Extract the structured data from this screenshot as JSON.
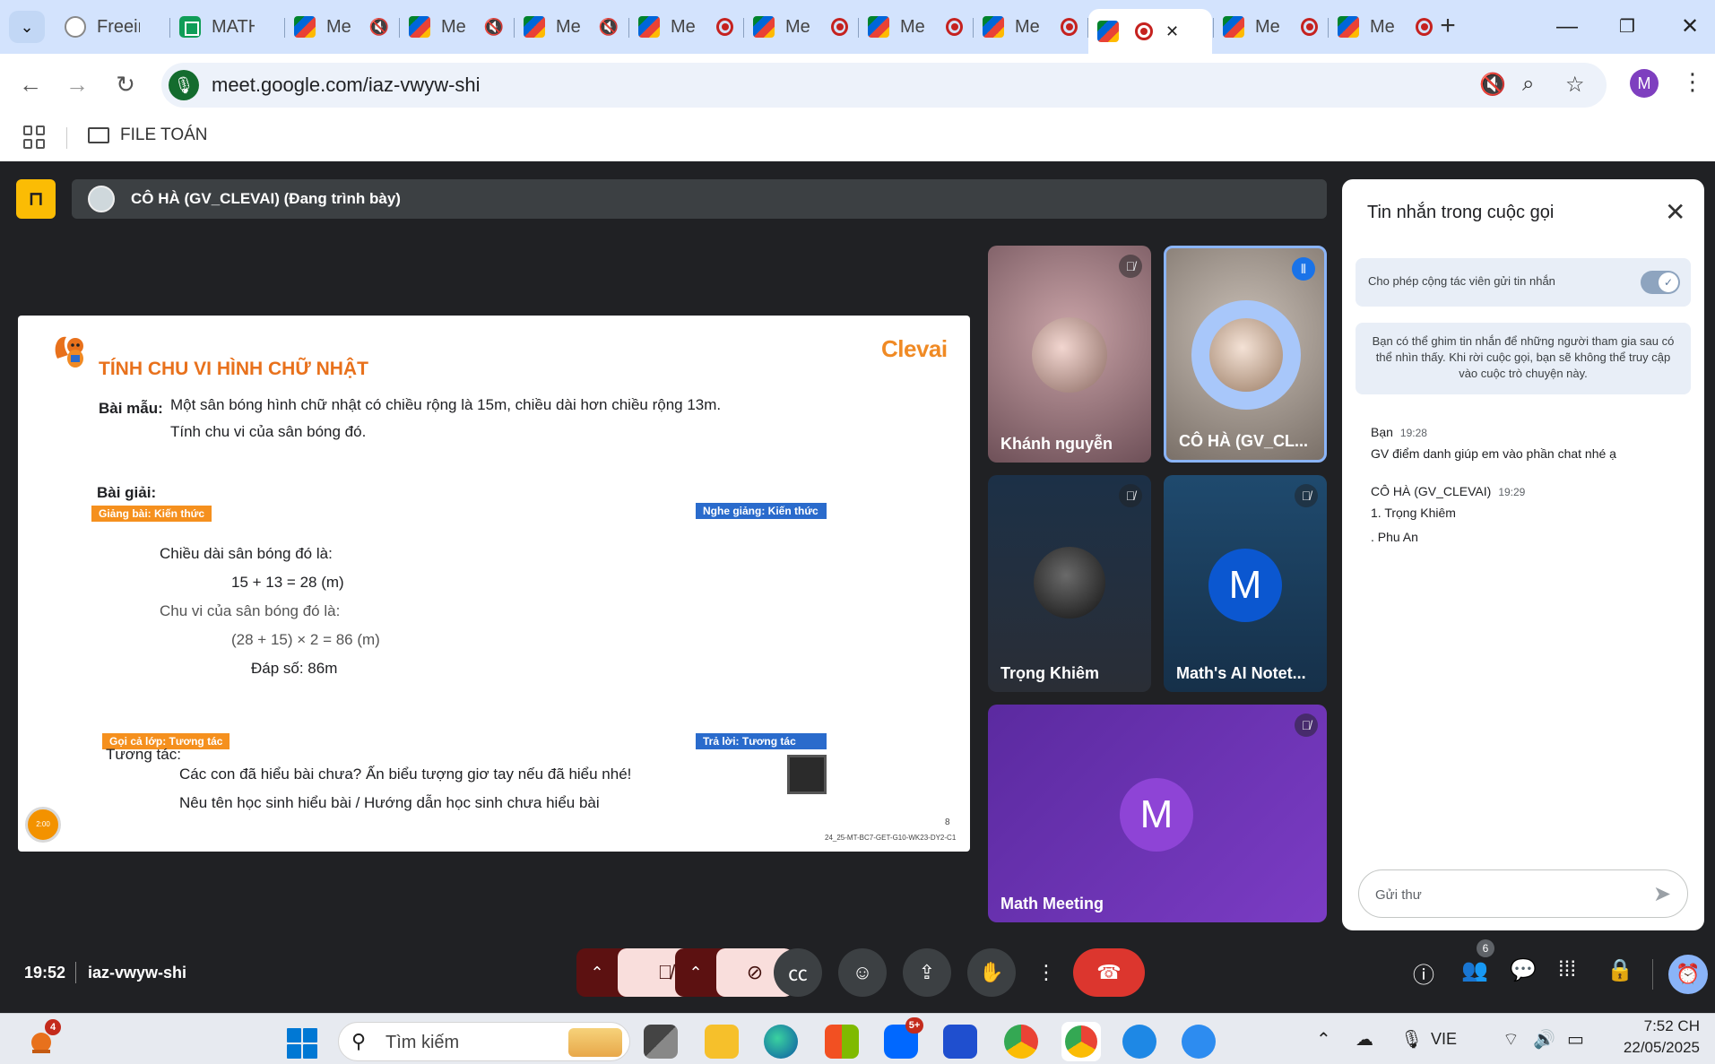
{
  "browser": {
    "tabs": [
      {
        "title": "Freeima",
        "favicon": "page-icon",
        "state": "none"
      },
      {
        "title": "MATH_",
        "favicon": "sheets-icon",
        "state": "none"
      },
      {
        "title": "Me",
        "favicon": "meet-icon",
        "state": "muted"
      },
      {
        "title": "Me",
        "favicon": "meet-icon",
        "state": "muted"
      },
      {
        "title": "Me",
        "favicon": "meet-icon",
        "state": "muted"
      },
      {
        "title": "Me",
        "favicon": "meet-icon",
        "state": "recording"
      },
      {
        "title": "Me",
        "favicon": "meet-icon",
        "state": "recording"
      },
      {
        "title": "Me",
        "favicon": "meet-icon",
        "state": "recording"
      },
      {
        "title": "Me",
        "favicon": "meet-icon",
        "state": "recording"
      },
      {
        "title": "",
        "favicon": "meet-icon",
        "state": "recording-active"
      },
      {
        "title": "Me",
        "favicon": "meet-icon",
        "state": "recording"
      },
      {
        "title": "Me",
        "favicon": "meet-icon",
        "state": "recording"
      }
    ],
    "url": "meet.google.com/iaz-vwyw-shi",
    "profile_initial": "M",
    "bookmark_folder": "FILE TOÁN",
    "colors": {
      "tabbar": "#d3e3fd",
      "omnibox": "#edf2fa",
      "profile": "#7e3fbf"
    }
  },
  "meet": {
    "presenter_banner": "CÔ HÀ (GV_CLEVAI) (Đang trình bày)",
    "slide": {
      "title": "TÍNH CHU VI HÌNH CHỮ NHẬT",
      "brand": "Clevai",
      "example_label": "Bài mẫu:",
      "example_line1": "Một sân bóng hình chữ nhật có chiều rộng là 15m, chiều dài hơn chiều rộng 13m.",
      "example_line2": "Tính chu vi của sân bóng đó.",
      "solution_label": "Bài giải:",
      "tag_teach": "Giảng bài: Kiến thức",
      "tag_listen": "Nghe giảng: Kiến thức",
      "step1": "Chiều dài sân bóng đó là:",
      "calc1": "15 + 13 = 28 (m)",
      "step2": "Chu vi của sân bóng đó là:",
      "calc2": "(28 + 15) × 2 = 86 (m)",
      "answer": "Đáp số: 86m",
      "tag_call": "Gọi cả lớp: Tương tác",
      "tag_reply": "Trả lời: Tương tác",
      "interact_label": "Tương tác:",
      "interact_line1": "Các con đã hiểu bài chưa? Ấn biểu tượng giơ tay nếu đã hiểu nhé!",
      "interact_line2": "Nêu tên học sinh hiểu bài / Hướng dẫn học sinh chưa hiểu bài",
      "timer": "2:00",
      "page_number": "8",
      "code": "24_25-MT-BC7-GET-G10-WK23-DY2-C1"
    },
    "participants": [
      {
        "name": "Khánh nguyễn",
        "mic": "muted",
        "avatar": "photo"
      },
      {
        "name": "CÔ HÀ (GV_CL...",
        "mic": "speaking",
        "avatar": "photo"
      },
      {
        "name": "Trọng Khiêm",
        "mic": "muted",
        "avatar": "photo"
      },
      {
        "name": "Math's AI Notet...",
        "mic": "muted",
        "avatar": "letter",
        "letter": "M"
      },
      {
        "name": "Math Meeting",
        "mic": "muted",
        "avatar": "letter",
        "letter": "M"
      }
    ],
    "chat": {
      "title": "Tin nhắn trong cuộc gọi",
      "allow_label": "Cho phép cộng tác viên gửi tin nhắn",
      "allow_enabled": true,
      "pin_info": "Bạn có thể ghim tin nhắn để những người tham gia sau có thể nhìn thấy. Khi rời cuộc gọi, bạn sẽ không thể truy cập vào cuộc trò chuyện này.",
      "messages": [
        {
          "sender": "Bạn",
          "time": "19:28",
          "lines": [
            "GV điểm danh giúp em vào phần chat nhé ạ"
          ]
        },
        {
          "sender": "CÔ HÀ (GV_CLEVAI)",
          "time": "19:29",
          "lines": [
            "1. Trọng Khiêm",
            ". Phu An"
          ]
        }
      ],
      "input_placeholder": "Gửi thư"
    },
    "bottom": {
      "time": "19:52",
      "meeting_code": "iaz-vwyw-shi",
      "people_count": "6"
    }
  },
  "taskbar": {
    "weather_badge": "4",
    "search_placeholder": "Tìm kiếm",
    "zalo_badge": "5+",
    "language": "VIE",
    "time": "7:52 CH",
    "date": "22/05/2025"
  }
}
